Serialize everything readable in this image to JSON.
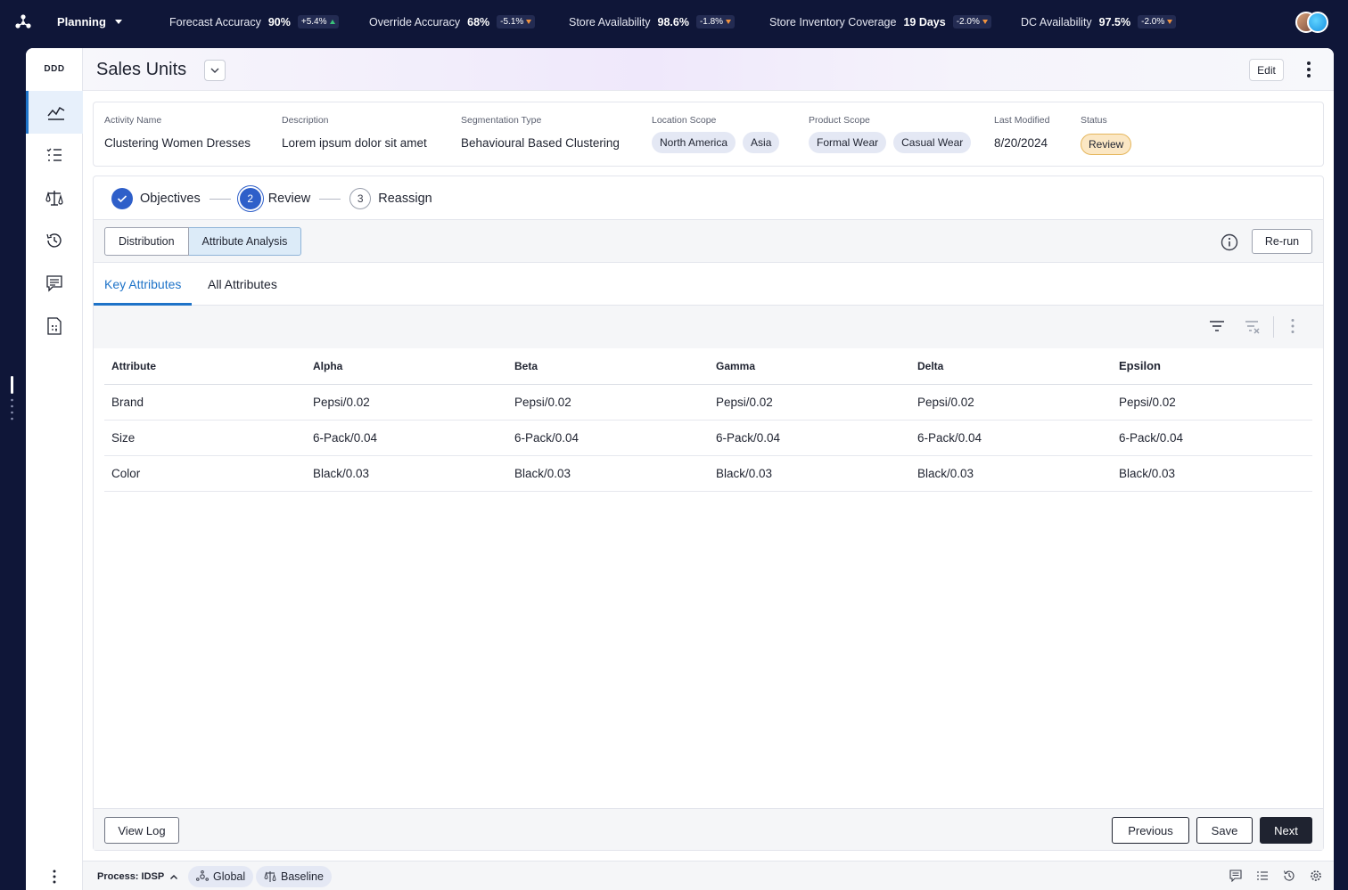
{
  "topbar": {
    "app_label": "Planning",
    "kpis": [
      {
        "label": "Forecast Accuracy",
        "value": "90%",
        "change": "+5.4%",
        "trend": "up"
      },
      {
        "label": "Override Accuracy",
        "value": "68%",
        "change": "-5.1%",
        "trend": "down"
      },
      {
        "label": "Store Availability",
        "value": "98.6%",
        "change": "-1.8%",
        "trend": "down"
      },
      {
        "label": "Store Inventory Coverage",
        "value": "19 Days",
        "change": "-2.0%",
        "trend": "down"
      },
      {
        "label": "DC Availability",
        "value": "97.5%",
        "change": "-2.0%",
        "trend": "down"
      }
    ]
  },
  "rail": {
    "brand": "DDD",
    "items": [
      "chart-line-icon",
      "list-icon",
      "scale-icon",
      "history-icon",
      "comment-list-icon",
      "calculator-doc-icon"
    ]
  },
  "header": {
    "title": "Sales Units",
    "edit_label": "Edit"
  },
  "info": {
    "activity_name_label": "Activity Name",
    "activity_name": "Clustering Women Dresses",
    "description_label": "Description",
    "description": "Lorem ipsum dolor sit amet",
    "segmentation_label": "Segmentation Type",
    "segmentation": "Behavioural Based Clustering",
    "location_label": "Location Scope",
    "locations": [
      "North America",
      "Asia"
    ],
    "product_label": "Product Scope",
    "products": [
      "Formal Wear",
      "Casual Wear"
    ],
    "modified_label": "Last Modified",
    "modified": "8/20/2024",
    "status_label": "Status",
    "status": "Review"
  },
  "stepper": {
    "steps": [
      {
        "label": "Objectives",
        "number": "",
        "state": "done"
      },
      {
        "label": "Review",
        "number": "2",
        "state": "current"
      },
      {
        "label": "Reassign",
        "number": "3",
        "state": "todo"
      }
    ]
  },
  "view_toggle": {
    "options": [
      "Distribution",
      "Attribute Analysis"
    ],
    "selected": "Attribute Analysis",
    "rerun_label": "Re-run"
  },
  "tabs": {
    "items": [
      "Key Attributes",
      "All Attributes"
    ],
    "active": "Key Attributes"
  },
  "table": {
    "headers": [
      "Attribute",
      "Alpha",
      "Beta",
      "Gamma",
      "Delta",
      "Epsilon"
    ],
    "rows": [
      [
        "Brand",
        "Pepsi/0.02",
        "Pepsi/0.02",
        "Pepsi/0.02",
        "Pepsi/0.02",
        "Pepsi/0.02"
      ],
      [
        "Size",
        "6-Pack/0.04",
        "6-Pack/0.04",
        "6-Pack/0.04",
        "6-Pack/0.04",
        "6-Pack/0.04"
      ],
      [
        "Color",
        "Black/0.03",
        "Black/0.03",
        "Black/0.03",
        "Black/0.03",
        "Black/0.03"
      ]
    ]
  },
  "footer": {
    "view_log": "View Log",
    "previous": "Previous",
    "save": "Save",
    "next": "Next"
  },
  "statusbar": {
    "process": "Process: IDSP",
    "global": "Global",
    "baseline": "Baseline"
  },
  "colors": {
    "accent": "#1e73c8",
    "step": "#2e5fc9",
    "topbar_bg": "#0f1638",
    "status_badge": "#fbe7c4"
  }
}
